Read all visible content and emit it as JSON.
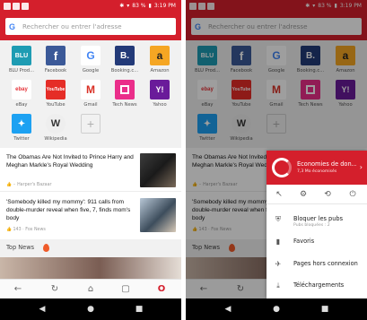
{
  "status": {
    "battery": "83 %",
    "time": "3:19 PM"
  },
  "address": {
    "placeholder": "Rechercher ou entrer l'adresse",
    "google_letter": "G"
  },
  "speed_dial": [
    {
      "label": "BLU Prod...",
      "tile_text": "BLU",
      "color": "#1e9cb3"
    },
    {
      "label": "Facebook",
      "tile_text": "f",
      "color": "#3b5998"
    },
    {
      "label": "Google",
      "tile_text": "G",
      "color": "#ffffff"
    },
    {
      "label": "Booking.c...",
      "tile_text": "B.",
      "color": "#233a78"
    },
    {
      "label": "Amazon",
      "tile_text": "a",
      "color": "#f5a623"
    },
    {
      "label": "eBay",
      "tile_text": "ebay",
      "color": "#ffffff"
    },
    {
      "label": "YouTube",
      "tile_text": "YouTube",
      "color": "#e52d27"
    },
    {
      "label": "Gmail",
      "tile_text": "M",
      "color": "#ffffff"
    },
    {
      "label": "Tech News",
      "tile_text": "",
      "color": "#ea2e8a"
    },
    {
      "label": "Yahoo",
      "tile_text": "Y!",
      "color": "#6a1b9a"
    },
    {
      "label": "Twitter",
      "tile_text": "",
      "color": "#1da1f2"
    },
    {
      "label": "Wikipedia",
      "tile_text": "W",
      "color": "#eeeeee"
    }
  ],
  "articles": [
    {
      "title": "The Obamas Are Not Invited to Prince Harry and Meghan Markle's Royal Wedding",
      "meta": "Harper's Bazaar"
    },
    {
      "title": "'Somebody killed my mommy': 911 calls from double-murder reveal when five, 7, finds mom's body",
      "meta": "Fox News"
    }
  ],
  "article_meta_left": {
    "likes_1": "",
    "likes_2": "143"
  },
  "top_news": "Top News",
  "menu": {
    "savings_title": "Économies de don...",
    "savings_sub": "7,3 Mo économisés",
    "items": [
      {
        "label": "Bloquer les pubs",
        "sub": "Pubs bloquées : 2"
      },
      {
        "label": "Favoris",
        "sub": ""
      },
      {
        "label": "Pages hors connexion",
        "sub": ""
      },
      {
        "label": "Téléchargements",
        "sub": ""
      }
    ]
  },
  "colors": {
    "opera_red": "#d41f2c"
  }
}
